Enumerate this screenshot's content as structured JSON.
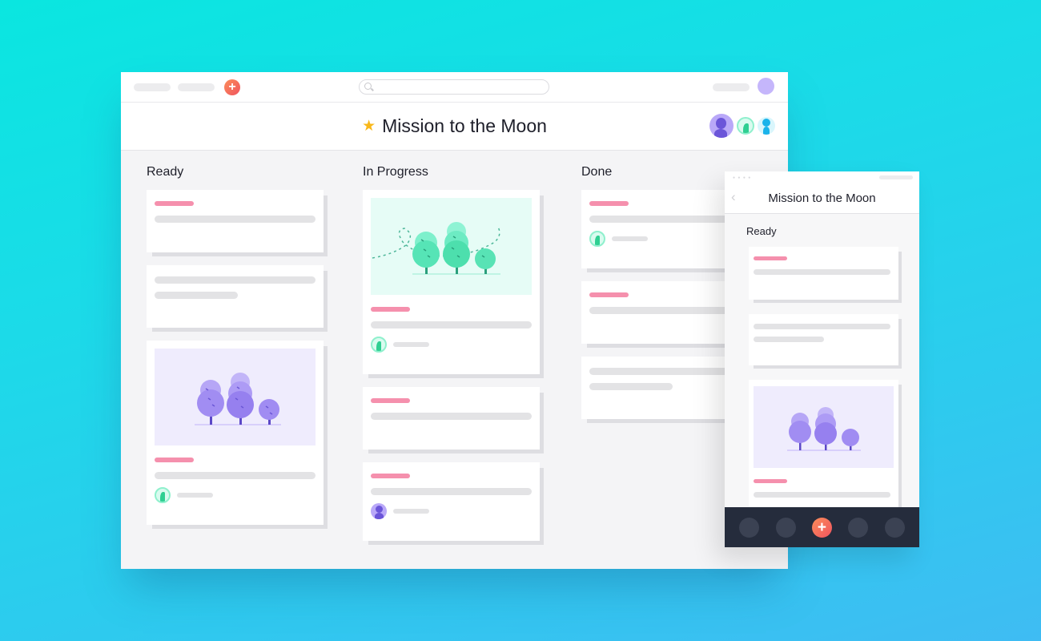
{
  "desktop": {
    "topbar": {
      "add_button_icon": "+",
      "search_placeholder": ""
    },
    "header": {
      "star_icon": "★",
      "title": "Mission to the Moon",
      "members": [
        "member-purple",
        "member-green",
        "member-blue"
      ]
    },
    "columns": [
      {
        "title": "Ready"
      },
      {
        "title": "In Progress"
      },
      {
        "title": "Done"
      }
    ]
  },
  "mobile": {
    "back_icon": "‹",
    "title": "Mission to the Moon",
    "column_title": "Ready",
    "tabbar": {
      "add_button_icon": "+"
    }
  },
  "colors": {
    "accent": "#f0545f",
    "tag": "#f590ad",
    "star": "#f9b81a",
    "purple": "#8b74f0",
    "green": "#3fe0ab"
  }
}
